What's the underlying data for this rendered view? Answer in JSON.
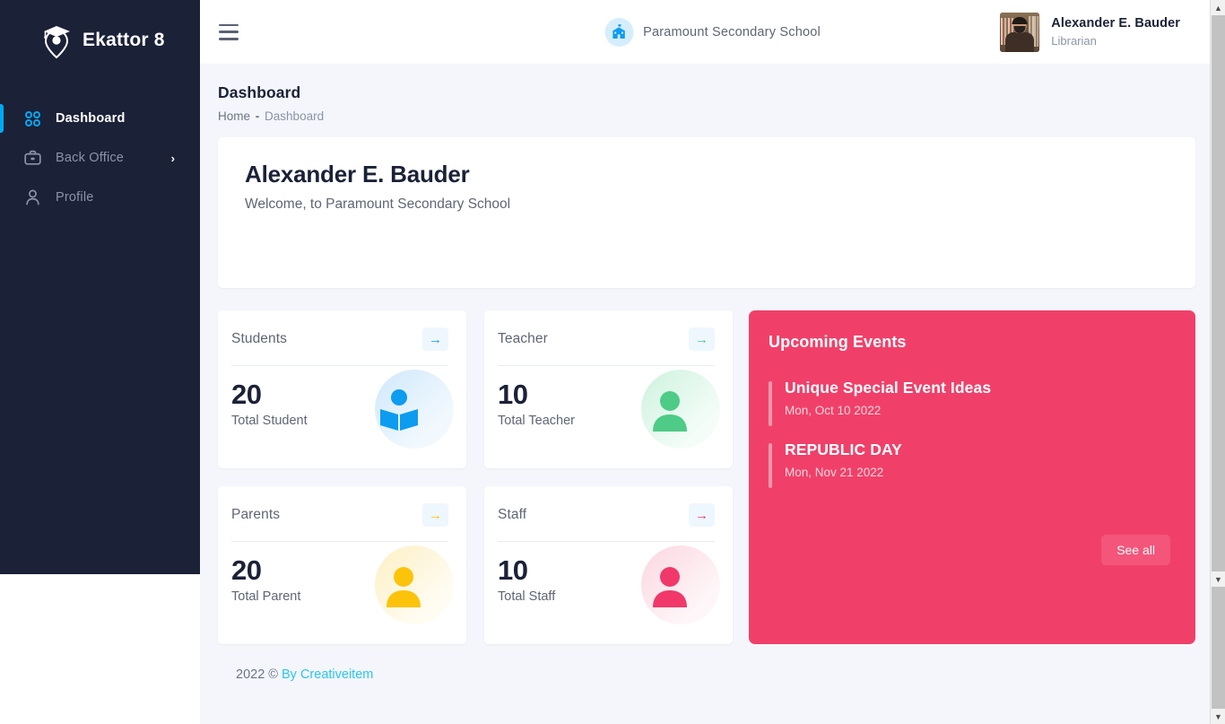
{
  "brand": {
    "name": "Ekattor 8",
    "logo_icon": "graduation-cap-pin-logo"
  },
  "sidebar": {
    "items": [
      {
        "label": "Dashboard",
        "icon": "grid-icon",
        "active": true,
        "has_chevron": false
      },
      {
        "label": "Back Office",
        "icon": "briefcase-icon",
        "active": false,
        "has_chevron": true,
        "chevron": "›"
      },
      {
        "label": "Profile",
        "icon": "user-icon",
        "active": false,
        "has_chevron": false
      }
    ]
  },
  "topbar": {
    "menu_icon": "hamburger-icon",
    "school_icon": "school-building-icon",
    "school_name": "Paramount Secondary School",
    "user": {
      "avatar_icon": "user-avatar",
      "name": "Alexander E. Bauder",
      "role": "Librarian"
    }
  },
  "page": {
    "title": "Dashboard",
    "breadcrumb": {
      "home": "Home",
      "separator": "-",
      "current": "Dashboard"
    }
  },
  "welcome": {
    "name": "Alexander E. Bauder",
    "message": "Welcome, to Paramount Secondary School"
  },
  "stats": [
    {
      "title": "Students",
      "value": "20",
      "label": "Total Student",
      "arrow": "→",
      "color": "#0d9cf0",
      "illus_icon": "student-reading-icon",
      "circle_from": "#cfe8fb",
      "circle_to": "#f2f9fe"
    },
    {
      "title": "Teacher",
      "value": "10",
      "label": "Total Teacher",
      "arrow": "→",
      "color": "#4ecb86",
      "illus_icon": "teacher-person-icon",
      "circle_from": "#cdf2de",
      "circle_to": "#f4fdf8"
    },
    {
      "title": "Parents",
      "value": "20",
      "label": "Total Parent",
      "arrow": "→",
      "color": "#fcc30b",
      "illus_icon": "parent-person-icon",
      "circle_from": "#fdf0c4",
      "circle_to": "#fffcf2"
    },
    {
      "title": "Staff",
      "value": "10",
      "label": "Total Staff",
      "arrow": "→",
      "color": "#f0396a",
      "illus_icon": "staff-person-icon",
      "circle_from": "#fbd6e0",
      "circle_to": "#fef6f8"
    }
  ],
  "events": {
    "title": "Upcoming Events",
    "panel_color": "#f04069",
    "see_all_label": "See all",
    "items": [
      {
        "name": "Unique Special Event Ideas",
        "date": "Mon, Oct 10 2022"
      },
      {
        "name": "REPUBLIC DAY",
        "date": "Mon, Nov 21 2022"
      }
    ]
  },
  "footer": {
    "copyright": "2022 © ",
    "link": "By Creativeitem",
    "link_color": "#29c6f2"
  }
}
